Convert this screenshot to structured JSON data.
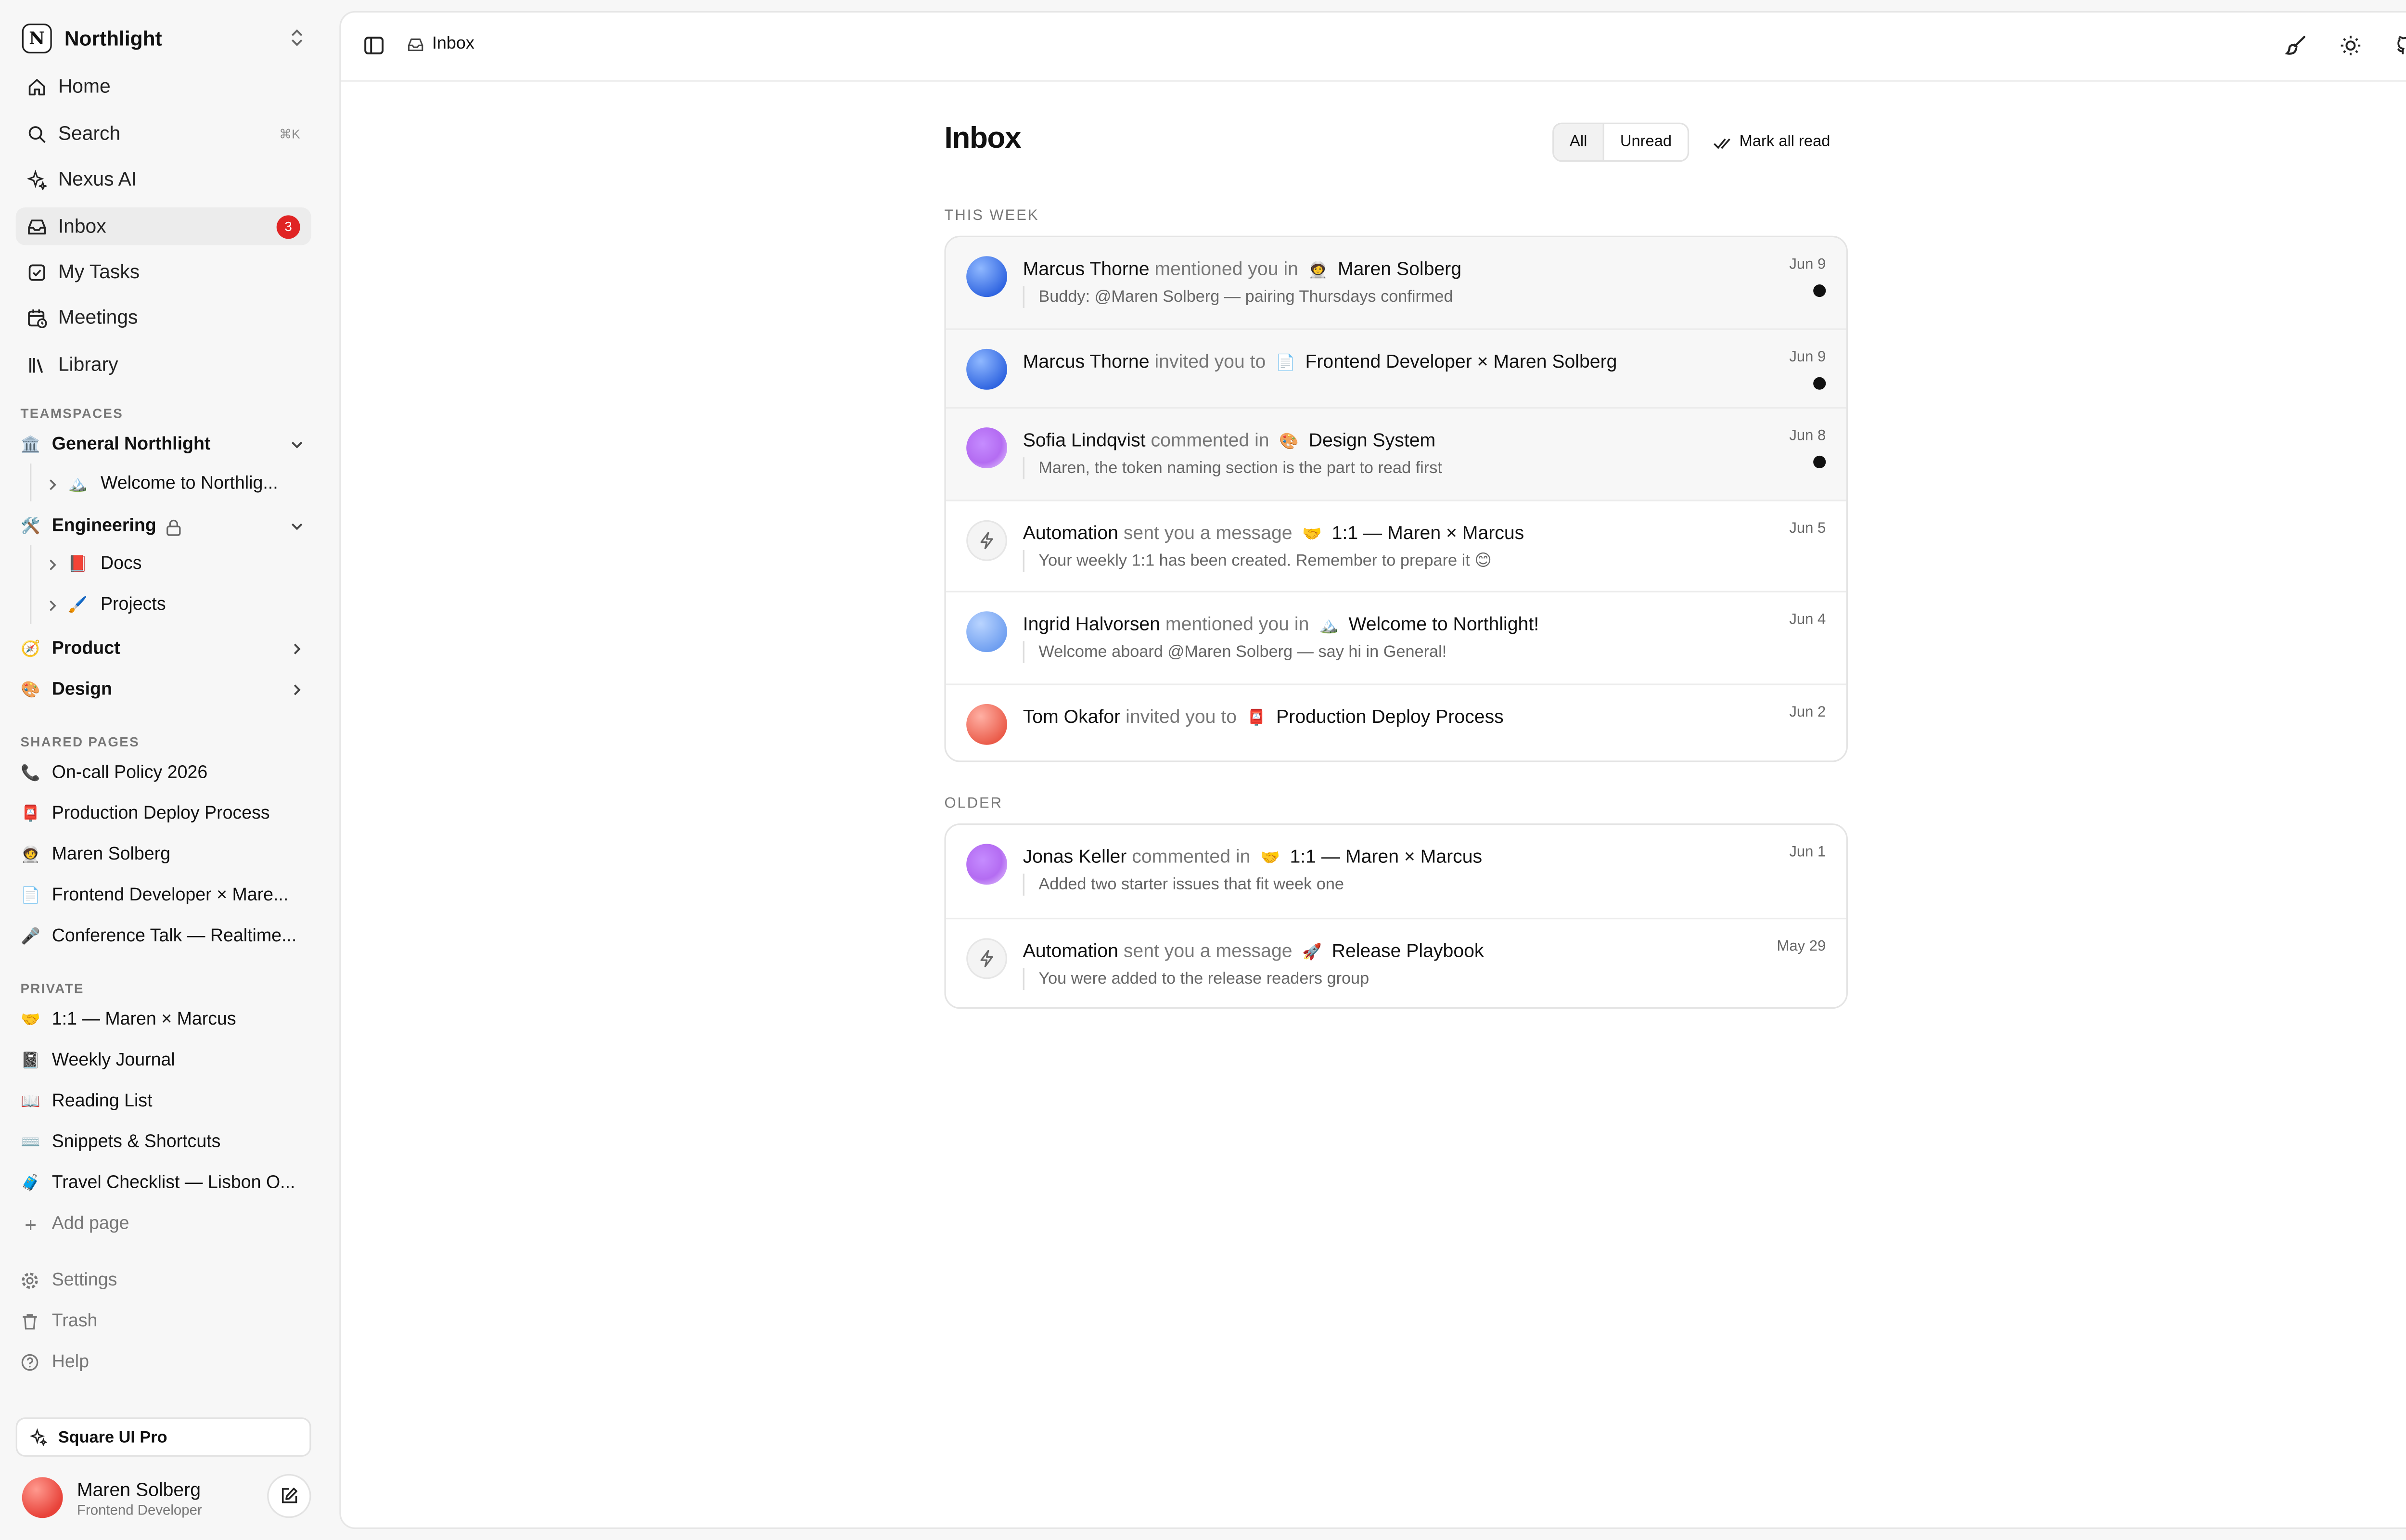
{
  "workspace": {
    "name": "Northlight",
    "logo_letter": "N"
  },
  "nav": [
    {
      "label": "Home",
      "icon": "home-icon"
    },
    {
      "label": "Search",
      "icon": "search-icon",
      "shortcut": "⌘K"
    },
    {
      "label": "Nexus AI",
      "icon": "sparkle-icon"
    },
    {
      "label": "Inbox",
      "icon": "inbox-icon",
      "badge": "3",
      "active": true
    },
    {
      "label": "My Tasks",
      "icon": "checkbox-icon"
    },
    {
      "label": "Meetings",
      "icon": "calendar-clock-icon"
    },
    {
      "label": "Library",
      "icon": "library-icon"
    }
  ],
  "teamspaces": {
    "heading": "TEAMSPACES",
    "general": {
      "emoji": "🏛️",
      "label": "General Northlight",
      "child": {
        "emoji": "🏔️",
        "label": "Welcome to Northlig..."
      }
    },
    "engineering": {
      "emoji": "🛠️",
      "label": "Engineering",
      "children": [
        {
          "emoji": "📕",
          "label": "Docs"
        },
        {
          "emoji": "🖌️",
          "label": "Projects"
        }
      ]
    },
    "product": {
      "emoji": "🧭",
      "label": "Product"
    },
    "design": {
      "emoji": "🎨",
      "label": "Design"
    }
  },
  "shared": {
    "heading": "SHARED PAGES",
    "pages": [
      {
        "emoji": "📞",
        "label": "On-call Policy 2026"
      },
      {
        "emoji": "📮",
        "label": "Production Deploy Process"
      },
      {
        "emoji": "🧑‍🚀",
        "label": "Maren Solberg"
      },
      {
        "emoji": "📄",
        "label": "Frontend Developer × Mare..."
      },
      {
        "emoji": "🎤",
        "label": "Conference Talk — Realtime..."
      }
    ]
  },
  "private": {
    "heading": "PRIVATE",
    "pages": [
      {
        "emoji": "🤝",
        "label": "1:1 — Maren × Marcus"
      },
      {
        "emoji": "📓",
        "label": "Weekly Journal"
      },
      {
        "emoji": "📖",
        "label": "Reading List"
      },
      {
        "emoji": "⌨️",
        "label": "Snippets & Shortcuts"
      },
      {
        "emoji": "🧳",
        "label": "Travel Checklist — Lisbon O..."
      }
    ],
    "add_page": "Add page"
  },
  "footer": {
    "settings": "Settings",
    "trash": "Trash",
    "help": "Help",
    "promo": "Square UI Pro"
  },
  "user": {
    "name": "Maren Solberg",
    "role": "Frontend Developer"
  },
  "topbar": {
    "crumb": "Inbox"
  },
  "inbox": {
    "title": "Inbox",
    "filters": {
      "all": "All",
      "unread": "Unread"
    },
    "mark_all": "Mark all read",
    "this_week_heading": "THIS WEEK",
    "older_heading": "OLDER",
    "this_week": [
      {
        "actor": "Marcus Thorne",
        "verb": "mentioned you in",
        "emoji": "🧑‍🚀",
        "doc": "Maren Solberg",
        "quote": "Buddy: @Maren Solberg — pairing Thursdays confirmed",
        "date": "Jun 9",
        "unread": true
      },
      {
        "actor": "Marcus Thorne",
        "verb": "invited you to",
        "emoji": "📄",
        "doc": "Frontend Developer × Maren Solberg",
        "date": "Jun 9",
        "unread": true
      },
      {
        "actor": "Sofia Lindqvist",
        "verb": "commented in",
        "emoji": "🎨",
        "doc": "Design System",
        "quote": "Maren, the token naming section is the part to read first",
        "date": "Jun 8",
        "unread": true
      },
      {
        "actor": "Automation",
        "verb": "sent you a message",
        "emoji": "🤝",
        "doc": "1:1 — Maren × Marcus",
        "quote": "Your weekly 1:1 has been created. Remember to prepare it 😊",
        "date": "Jun 5"
      },
      {
        "actor": "Ingrid Halvorsen",
        "verb": "mentioned you in",
        "emoji": "🏔️",
        "doc": "Welcome to Northlight!",
        "quote": "Welcome aboard @Maren Solberg — say hi in General!",
        "date": "Jun 4"
      },
      {
        "actor": "Tom Okafor",
        "verb": "invited you to",
        "emoji": "📮",
        "doc": "Production Deploy Process",
        "date": "Jun 2"
      }
    ],
    "older": [
      {
        "actor": "Jonas Keller",
        "verb": "commented in",
        "emoji": "🤝",
        "doc": "1:1 — Maren × Marcus",
        "quote": "Added two starter issues that fit week one",
        "date": "Jun 1"
      },
      {
        "actor": "Automation",
        "verb": "sent you a message",
        "emoji": "🚀",
        "doc": "Release Playbook",
        "quote": "You were added to the release readers group",
        "date": "May 29"
      }
    ]
  },
  "colors": {
    "accent_badge": "#e02424",
    "unread_dot": "#111111",
    "unread_row_bg": "#f7f7f7"
  }
}
